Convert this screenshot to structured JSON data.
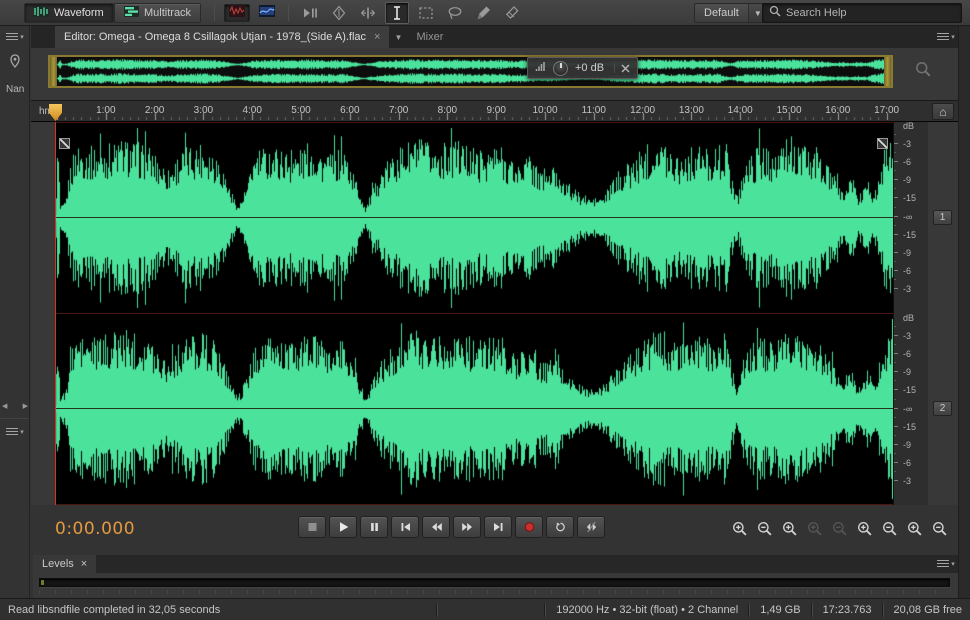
{
  "toolbar": {
    "waveform_label": "Waveform",
    "multitrack_label": "Multitrack",
    "workspace_label": "Default",
    "search_placeholder": "Search Help",
    "tools": [
      {
        "name": "move-tool",
        "icon": "move",
        "active": false
      },
      {
        "name": "razor-tool",
        "icon": "razor",
        "active": false
      },
      {
        "name": "slip-tool",
        "icon": "slip",
        "active": false
      },
      {
        "name": "time-selection-tool",
        "icon": "ibeam",
        "active": true
      },
      {
        "name": "marquee-selection-tool",
        "icon": "marquee",
        "active": false
      },
      {
        "name": "lasso-selection-tool",
        "icon": "lasso",
        "active": false
      },
      {
        "name": "paintbrush-selection-tool",
        "icon": "brush",
        "active": false
      },
      {
        "name": "eraser-tool",
        "icon": "eraser",
        "active": false
      }
    ]
  },
  "tabs": {
    "editor_label": "Editor: Omega - Omega 8 Csillagok Utjan - 1978_(Side A).flac",
    "mixer_label": "Mixer"
  },
  "glyphs": {
    "close": "×",
    "caret_down": "▾",
    "home": "⌂",
    "scroll_left": "◀",
    "scroll_right": "▶"
  },
  "left_dock": {
    "name_label": "Nan"
  },
  "hud": {
    "gain_label": "+0 dB"
  },
  "ruler": {
    "unit_label": "hms",
    "labels": [
      "1:00",
      "2:00",
      "3:00",
      "4:00",
      "5:00",
      "6:00",
      "7:00",
      "8:00",
      "9:00",
      "10:00",
      "11:00",
      "12:00",
      "13:00",
      "14:00",
      "15:00",
      "16:00",
      "17:00"
    ]
  },
  "db_scale": {
    "labels": [
      "dB",
      "-3",
      "-6",
      "-9",
      "-15",
      "-∞",
      "-15",
      "-9",
      "-6",
      "-3"
    ]
  },
  "channels": [
    {
      "label": "1"
    },
    {
      "label": "2"
    }
  ],
  "transport": {
    "time_display": "0:00.000",
    "buttons": [
      {
        "name": "stop-button",
        "icon": "stop"
      },
      {
        "name": "play-button",
        "icon": "play"
      },
      {
        "name": "pause-button",
        "icon": "pause"
      },
      {
        "name": "skip-to-start-button",
        "icon": "prev"
      },
      {
        "name": "rewind-button",
        "icon": "rew"
      },
      {
        "name": "fast-forward-button",
        "icon": "ffwd"
      },
      {
        "name": "skip-to-end-button",
        "icon": "next"
      },
      {
        "name": "record-button",
        "icon": "record"
      },
      {
        "name": "loop-playback-button",
        "icon": "loop"
      },
      {
        "name": "skip-selection-button",
        "icon": "skipsel"
      }
    ]
  },
  "zoom": {
    "buttons": [
      {
        "name": "zoom-in-button",
        "mod": "plus",
        "disabled": false
      },
      {
        "name": "zoom-out-button",
        "mod": "minus",
        "disabled": false
      },
      {
        "name": "zoom-to-selection-button",
        "mod": "plus",
        "disabled": false
      },
      {
        "name": "zoom-in-at-in-point-button",
        "mod": "plus",
        "disabled": true
      },
      {
        "name": "zoom-in-at-out-point-button",
        "mod": "minus",
        "disabled": true
      },
      {
        "name": "zoom-in-amplitude-button",
        "mod": "plus",
        "disabled": false
      },
      {
        "name": "zoom-out-amplitude-button",
        "mod": "minus",
        "disabled": false
      },
      {
        "name": "zoom-in-time-button",
        "mod": "plus",
        "disabled": false
      },
      {
        "name": "zoom-out-time-button",
        "mod": "minus",
        "disabled": false
      }
    ]
  },
  "levels_panel": {
    "tab_label": "Levels"
  },
  "status_bar": {
    "message": "Read libsndfile completed in 32,05 seconds",
    "format_label": "192000 Hz • 32-bit (float) • 2 Channel",
    "file_size": "1,49 GB",
    "duration": "17:23.763",
    "free_space": "20,08 GB free"
  },
  "waveform": {
    "color": "#4be29c",
    "envelope": [
      [
        0,
        0.04
      ],
      [
        0.003,
        0.9
      ],
      [
        0.006,
        0.12
      ],
      [
        0.012,
        0.18
      ],
      [
        0.018,
        0.6
      ],
      [
        0.025,
        0.82
      ],
      [
        0.05,
        0.78
      ],
      [
        0.08,
        0.88
      ],
      [
        0.11,
        0.8
      ],
      [
        0.135,
        0.55
      ],
      [
        0.15,
        0.75
      ],
      [
        0.175,
        0.85
      ],
      [
        0.195,
        0.7
      ],
      [
        0.21,
        0.3
      ],
      [
        0.218,
        0.12
      ],
      [
        0.228,
        0.35
      ],
      [
        0.24,
        0.75
      ],
      [
        0.26,
        0.8
      ],
      [
        0.285,
        0.72
      ],
      [
        0.305,
        0.85
      ],
      [
        0.325,
        0.68
      ],
      [
        0.345,
        0.78
      ],
      [
        0.36,
        0.4
      ],
      [
        0.37,
        0.12
      ],
      [
        0.378,
        0.3
      ],
      [
        0.39,
        0.55
      ],
      [
        0.41,
        0.78
      ],
      [
        0.43,
        0.88
      ],
      [
        0.455,
        0.8
      ],
      [
        0.48,
        0.86
      ],
      [
        0.505,
        0.75
      ],
      [
        0.53,
        0.82
      ],
      [
        0.55,
        0.6
      ],
      [
        0.565,
        0.72
      ],
      [
        0.58,
        0.5
      ],
      [
        0.595,
        0.58
      ],
      [
        0.61,
        0.4
      ],
      [
        0.625,
        0.28
      ],
      [
        0.64,
        0.22
      ],
      [
        0.655,
        0.25
      ],
      [
        0.665,
        0.42
      ],
      [
        0.675,
        0.55
      ],
      [
        0.69,
        0.65
      ],
      [
        0.705,
        0.82
      ],
      [
        0.725,
        0.86
      ],
      [
        0.745,
        0.72
      ],
      [
        0.765,
        0.8
      ],
      [
        0.785,
        0.76
      ],
      [
        0.8,
        0.84
      ],
      [
        0.808,
        0.45
      ],
      [
        0.814,
        0.25
      ],
      [
        0.822,
        0.6
      ],
      [
        0.84,
        0.8
      ],
      [
        0.86,
        0.74
      ],
      [
        0.88,
        0.84
      ],
      [
        0.9,
        0.78
      ],
      [
        0.915,
        0.68
      ],
      [
        0.928,
        0.48
      ],
      [
        0.94,
        0.3
      ],
      [
        0.95,
        0.5
      ],
      [
        0.958,
        0.22
      ],
      [
        0.968,
        0.45
      ],
      [
        0.978,
        0.28
      ],
      [
        0.988,
        0.75
      ],
      [
        1,
        0.92
      ]
    ]
  }
}
